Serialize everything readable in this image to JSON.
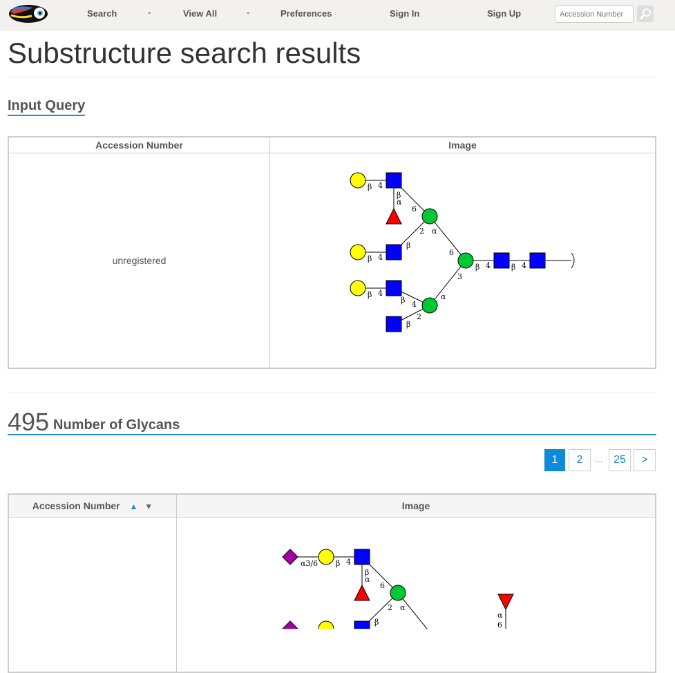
{
  "nav": {
    "search": "Search",
    "view_all": "View All",
    "preferences": "Preferences",
    "sign_in": "Sign In",
    "sign_up": "Sign Up",
    "search_placeholder": "Accession Number"
  },
  "page_title": "Substructure search results",
  "input_query": {
    "title": "Input Query",
    "col_accession": "Accession Number",
    "col_image": "Image",
    "accession_value": "unregistered"
  },
  "results": {
    "count": "495",
    "count_label": "Number of Glycans",
    "col_accession": "Accession Number",
    "col_image": "Image",
    "sort_up": "▲",
    "sort_down": "▼"
  },
  "pagination": {
    "p1": "1",
    "p2": "2",
    "ellipsis": "...",
    "last": "25",
    "next": ">"
  },
  "glycan_labels": {
    "beta": "β",
    "alpha": "α",
    "n2": "2",
    "n3": "3",
    "n4": "4",
    "n6": "6",
    "a36": "α3/6"
  },
  "colors": {
    "accent": "#1e88d6",
    "active_page": "#0d8ad8",
    "gal": "#ffff00",
    "glcnac": "#0000ff",
    "man": "#00c832",
    "fuc": "#ff0000",
    "neu5ac": "#a500a5"
  }
}
